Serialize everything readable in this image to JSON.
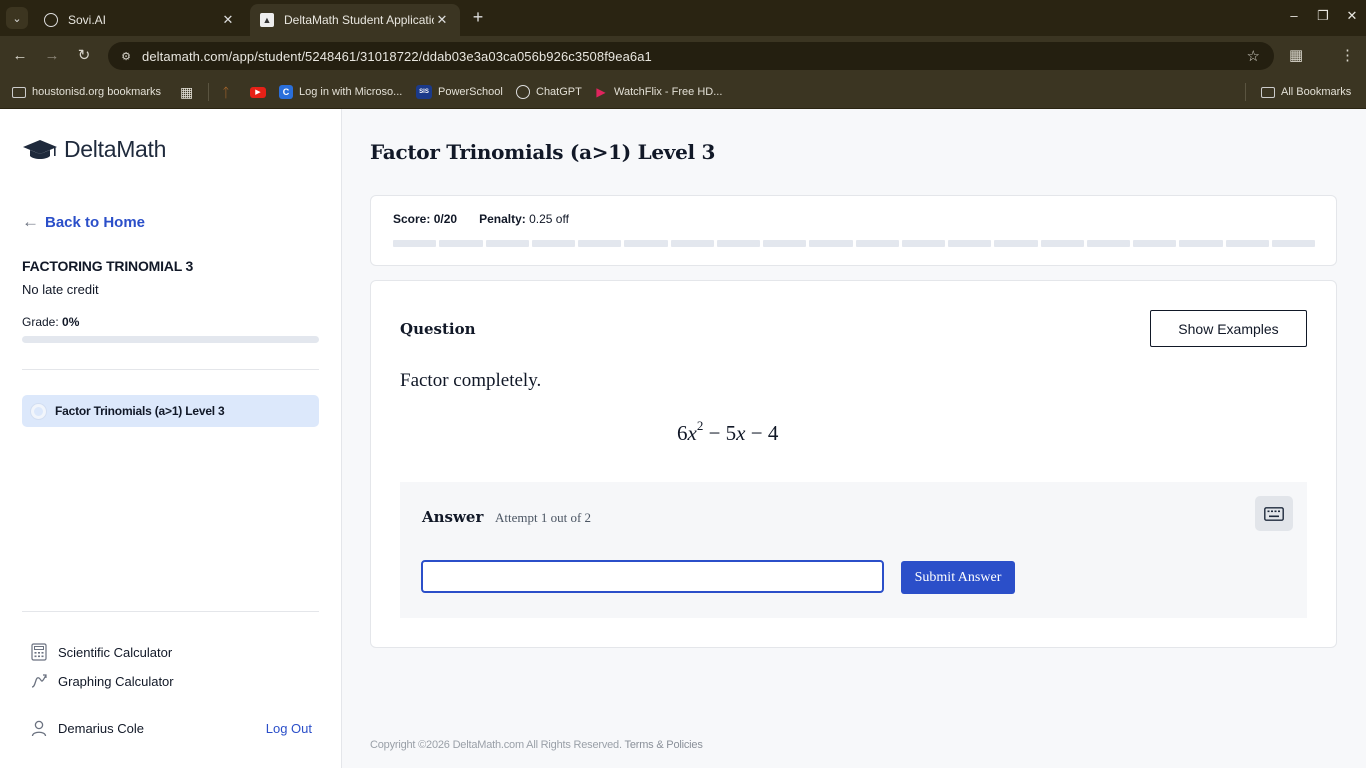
{
  "browser": {
    "tabs": [
      {
        "title": "Sovi.AI",
        "favicon": "sovi-logo-icon"
      },
      {
        "title": "DeltaMath Student Application",
        "favicon": "deltamath-cap-icon"
      }
    ],
    "url": "deltamath.com/app/student/5248461/31018722/ddab03e3a03ca056b926c3508f9ea6a1",
    "bookmarks": [
      {
        "label": "houstonisd.org bookmarks"
      },
      {
        "label": "Log in with Microso..."
      },
      {
        "label": "PowerSchool",
        "badge": "SIS"
      },
      {
        "label": "ChatGPT"
      },
      {
        "label": "WatchFlix - Free HD..."
      },
      {
        "label": "All Bookmarks"
      }
    ]
  },
  "sidebar": {
    "brand": "DeltaMath",
    "back_label": "Back to Home",
    "assignment_title": "FACTORING TRINOMIAL 3",
    "late_credit": "No late credit",
    "grade_label": "Grade:",
    "grade_value": "0%",
    "grade_progress": 0,
    "skills": [
      {
        "label": "Factor Trinomials (a>1) Level 3"
      }
    ],
    "tools": {
      "scientific": "Scientific Calculator",
      "graphing": "Graphing Calculator"
    },
    "user": {
      "name": "Demarius Cole",
      "logout": "Log Out"
    }
  },
  "main": {
    "skill_title": "Factor Trinomials (a>1) Level 3",
    "score_label": "Score:",
    "score_value": "0/20",
    "penalty_label": "Penalty:",
    "penalty_value": "0.25 off",
    "progress_segments": 20,
    "question": {
      "label": "Question",
      "show_examples": "Show Examples",
      "prompt": "Factor completely.",
      "expression": {
        "coef": "6",
        "var": "x",
        "exp": "2",
        "rest_1": "− 5",
        "var2": "x",
        "rest_2": "− 4"
      }
    },
    "answer": {
      "label": "Answer",
      "attempt": "Attempt 1 out of 2",
      "input_value": "",
      "submit": "Submit Answer"
    },
    "footer": {
      "copyright": "Copyright ©2026 DeltaMath.com All Rights Reserved.",
      "terms": "Terms & Policies"
    }
  },
  "colors": {
    "accent": "#2b4fc9",
    "highlight": "#dce8fb",
    "chrome": "#3b3522"
  }
}
